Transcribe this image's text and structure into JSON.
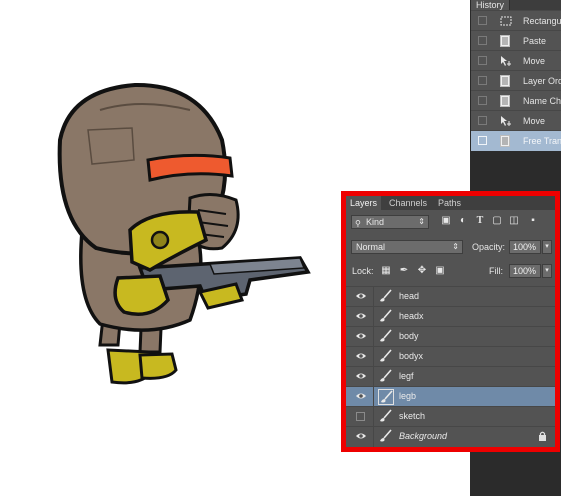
{
  "history": {
    "tab_label": "History",
    "items": [
      {
        "label": "Rectangular...",
        "icon": "rect-marquee-icon",
        "selected": false
      },
      {
        "label": "Paste",
        "icon": "document-icon",
        "selected": false
      },
      {
        "label": "Move",
        "icon": "move-tool-icon",
        "selected": false
      },
      {
        "label": "Layer Order",
        "icon": "document-icon",
        "selected": false
      },
      {
        "label": "Name Change",
        "icon": "document-icon",
        "selected": false
      },
      {
        "label": "Move",
        "icon": "move-tool-icon",
        "selected": false
      },
      {
        "label": "Free Transform",
        "icon": "document-icon",
        "selected": true
      }
    ]
  },
  "layers_panel": {
    "tabs": [
      "Layers",
      "Channels",
      "Paths"
    ],
    "active_tab": "Layers",
    "filter": {
      "value": "Kind",
      "icons": [
        "image-filter-icon",
        "adjustment-filter-icon",
        "type-filter-icon",
        "shape-filter-icon",
        "smart-object-filter-icon"
      ]
    },
    "blend_mode": "Normal",
    "opacity_label": "Opacity:",
    "opacity_value": "100%",
    "lock_label": "Lock:",
    "lock_icons": [
      "lock-transparent-icon",
      "lock-image-icon",
      "lock-position-icon",
      "lock-all-icon"
    ],
    "fill_label": "Fill:",
    "fill_value": "100%",
    "layers": [
      {
        "name": "head",
        "visible": true,
        "selected": false,
        "italic": false,
        "locked": false
      },
      {
        "name": "headx",
        "visible": true,
        "selected": false,
        "italic": false,
        "locked": false
      },
      {
        "name": "body",
        "visible": true,
        "selected": false,
        "italic": false,
        "locked": false
      },
      {
        "name": "bodyx",
        "visible": true,
        "selected": false,
        "italic": false,
        "locked": false
      },
      {
        "name": "legf",
        "visible": true,
        "selected": false,
        "italic": false,
        "locked": false
      },
      {
        "name": "legb",
        "visible": true,
        "selected": true,
        "italic": false,
        "locked": false
      },
      {
        "name": "sketch",
        "visible": false,
        "selected": false,
        "italic": false,
        "locked": false
      },
      {
        "name": "Background",
        "visible": true,
        "selected": false,
        "italic": true,
        "locked": true
      }
    ]
  },
  "colors": {
    "highlight_border": "#ee0000",
    "panel_bg": "#535353",
    "selected_layer": "#6f8aa8",
    "character_body": "#8a7767",
    "visor": "#ee5a2f",
    "gun_yellow": "#c8b920"
  }
}
